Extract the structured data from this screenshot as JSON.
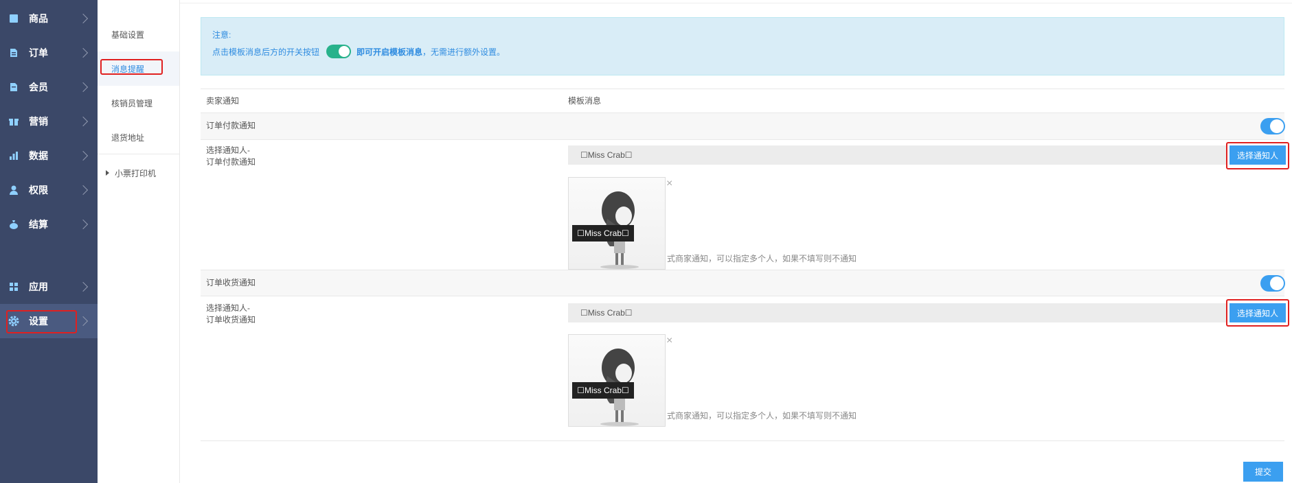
{
  "sidebar": {
    "items": [
      {
        "label": "商品",
        "icon": "box-icon"
      },
      {
        "label": "订单",
        "icon": "document-icon"
      },
      {
        "label": "会员",
        "icon": "member-card-icon"
      },
      {
        "label": "营销",
        "icon": "gift-icon"
      },
      {
        "label": "数据",
        "icon": "bar-chart-icon"
      },
      {
        "label": "权限",
        "icon": "user-key-icon"
      },
      {
        "label": "结算",
        "icon": "money-bag-icon"
      },
      {
        "label": "应用",
        "icon": "apps-grid-icon"
      },
      {
        "label": "设置",
        "icon": "gear-icon"
      }
    ]
  },
  "submenu": {
    "items": [
      "基础设置",
      "消息提醒",
      "核销员管理",
      "退货地址"
    ],
    "group": "小票打印机"
  },
  "notice": {
    "title": "注意:",
    "text_before": "点击模板消息后方的开关按钮",
    "text_bold": "即可开启模板消息",
    "text_after": "，无需进行额外设置。"
  },
  "table": {
    "col1": "卖家通知",
    "col2": "模板消息"
  },
  "sections": [
    {
      "title": "订单付款通知",
      "label_line1": "选择通知人-",
      "label_line2": "订单付款通知",
      "picker_value": "☐Miss Crab☐",
      "button": "选择通知人",
      "thumb_caption": "☐Miss Crab☐",
      "hint": "式商家通知，可以指定多个人，如果不填写则不通知"
    },
    {
      "title": "订单收货通知",
      "label_line1": "选择通知人-",
      "label_line2": "订单收货通知",
      "picker_value": "☐Miss Crab☐",
      "button": "选择通知人",
      "thumb_caption": "☐Miss Crab☐",
      "hint": "式商家通知，可以指定多个人，如果不填写则不通知"
    }
  ],
  "submit_label": "提交",
  "colors": {
    "sidebar_bg": "#3b4868",
    "accent": "#3b9ff0",
    "notice_bg": "#d9edf7",
    "highlight": "#e02020"
  }
}
